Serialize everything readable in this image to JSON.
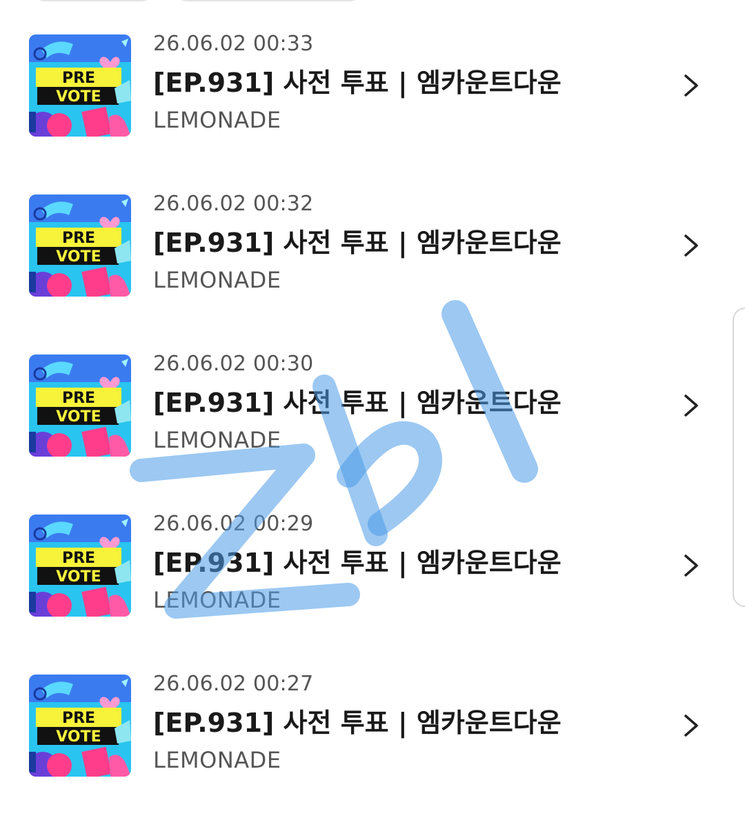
{
  "items": [
    {
      "date": "26.06.02 00:33",
      "title": "[EP.931] 사전 투표 | 엠카운트다운",
      "artist": "LEMONADE"
    },
    {
      "date": "26.06.02 00:32",
      "title": "[EP.931] 사전 투표 | 엠카운트다운",
      "artist": "LEMONADE"
    },
    {
      "date": "26.06.02 00:30",
      "title": "[EP.931] 사전 투표 | 엠카운트다운",
      "artist": "LEMONADE"
    },
    {
      "date": "26.06.02 00:29",
      "title": "[EP.931] 사전 투표 | 엠카운트다운",
      "artist": "LEMONADE"
    },
    {
      "date": "26.06.02 00:27",
      "title": "[EP.931] 사전 투표 | 엠카운트다운",
      "artist": "LEMONADE"
    }
  ],
  "thumbnail": {
    "line1": "PRE",
    "line2": "VOTE",
    "colors": {
      "bg": "#29c4f0",
      "yellow": "#f7f23a",
      "black": "#111111",
      "pink": "#ff3d8b",
      "purple": "#6a3fd8",
      "blue": "#2b5ce6"
    }
  },
  "icons": {
    "chevron": "chevron-right-icon"
  },
  "watermark": {
    "text": "Z비",
    "color": "#4a9be8"
  }
}
